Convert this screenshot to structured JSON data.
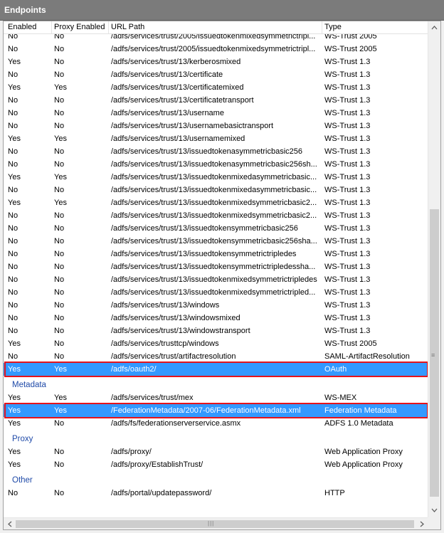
{
  "panel": {
    "title": "Endpoints"
  },
  "columns": [
    "Enabled",
    "Proxy Enabled",
    "URL Path",
    "Type"
  ],
  "groups": [
    {
      "name": "",
      "rows": [
        [
          "No",
          "No",
          "/adfs/services/trust/2005/issuedtokenmixedsymmetrictripl...",
          "WS-Trust 2005"
        ],
        [
          "No",
          "No",
          "/adfs/services/trust/2005/issuedtokenmixedsymmetrictripl...",
          "WS-Trust 2005"
        ],
        [
          "Yes",
          "No",
          "/adfs/services/trust/13/kerberosmixed",
          "WS-Trust 1.3"
        ],
        [
          "No",
          "No",
          "/adfs/services/trust/13/certificate",
          "WS-Trust 1.3"
        ],
        [
          "Yes",
          "Yes",
          "/adfs/services/trust/13/certificatemixed",
          "WS-Trust 1.3"
        ],
        [
          "No",
          "No",
          "/adfs/services/trust/13/certificatetransport",
          "WS-Trust 1.3"
        ],
        [
          "No",
          "No",
          "/adfs/services/trust/13/username",
          "WS-Trust 1.3"
        ],
        [
          "No",
          "No",
          "/adfs/services/trust/13/usernamebasictransport",
          "WS-Trust 1.3"
        ],
        [
          "Yes",
          "Yes",
          "/adfs/services/trust/13/usernamemixed",
          "WS-Trust 1.3"
        ],
        [
          "No",
          "No",
          "/adfs/services/trust/13/issuedtokenasymmetricbasic256",
          "WS-Trust 1.3"
        ],
        [
          "No",
          "No",
          "/adfs/services/trust/13/issuedtokenasymmetricbasic256sh...",
          "WS-Trust 1.3"
        ],
        [
          "Yes",
          "Yes",
          "/adfs/services/trust/13/issuedtokenmixedasymmetricbasic...",
          "WS-Trust 1.3"
        ],
        [
          "No",
          "No",
          "/adfs/services/trust/13/issuedtokenmixedasymmetricbasic...",
          "WS-Trust 1.3"
        ],
        [
          "Yes",
          "Yes",
          "/adfs/services/trust/13/issuedtokenmixedsymmetricbasic2...",
          "WS-Trust 1.3"
        ],
        [
          "No",
          "No",
          "/adfs/services/trust/13/issuedtokenmixedsymmetricbasic2...",
          "WS-Trust 1.3"
        ],
        [
          "No",
          "No",
          "/adfs/services/trust/13/issuedtokensymmetricbasic256",
          "WS-Trust 1.3"
        ],
        [
          "No",
          "No",
          "/adfs/services/trust/13/issuedtokensymmetricbasic256sha...",
          "WS-Trust 1.3"
        ],
        [
          "No",
          "No",
          "/adfs/services/trust/13/issuedtokensymmetrictripledes",
          "WS-Trust 1.3"
        ],
        [
          "No",
          "No",
          "/adfs/services/trust/13/issuedtokensymmetrictripledessha...",
          "WS-Trust 1.3"
        ],
        [
          "No",
          "No",
          "/adfs/services/trust/13/issuedtokenmixedsymmetrictripledes",
          "WS-Trust 1.3"
        ],
        [
          "No",
          "No",
          "/adfs/services/trust/13/issuedtokenmixedsymmetrictripled...",
          "WS-Trust 1.3"
        ],
        [
          "No",
          "No",
          "/adfs/services/trust/13/windows",
          "WS-Trust 1.3"
        ],
        [
          "No",
          "No",
          "/adfs/services/trust/13/windowsmixed",
          "WS-Trust 1.3"
        ],
        [
          "No",
          "No",
          "/adfs/services/trust/13/windowstransport",
          "WS-Trust 1.3"
        ],
        [
          "Yes",
          "No",
          "/adfs/services/trusttcp/windows",
          "WS-Trust 2005"
        ],
        [
          "No",
          "No",
          "/adfs/services/trust/artifactresolution",
          "SAML-ArtifactResolution"
        ],
        [
          "Yes",
          "Yes",
          "/adfs/oauth2/",
          "OAuth"
        ]
      ]
    },
    {
      "name": "Metadata",
      "rows": [
        [
          "Yes",
          "Yes",
          "/adfs/services/trust/mex",
          "WS-MEX"
        ],
        [
          "Yes",
          "Yes",
          "/FederationMetadata/2007-06/FederationMetadata.xml",
          "Federation Metadata"
        ],
        [
          "Yes",
          "No",
          "/adfs/fs/federationserverservice.asmx",
          "ADFS 1.0 Metadata"
        ]
      ]
    },
    {
      "name": "Proxy",
      "rows": [
        [
          "Yes",
          "No",
          "/adfs/proxy/",
          "Web Application Proxy"
        ],
        [
          "Yes",
          "No",
          "/adfs/proxy/EstablishTrust/",
          "Web Application Proxy"
        ]
      ]
    },
    {
      "name": "Other",
      "rows": [
        [
          "No",
          "No",
          "/adfs/portal/updatepassword/",
          "HTTP"
        ]
      ]
    }
  ],
  "selected": [
    "/adfs/oauth2/",
    "/FederationMetadata/2007-06/FederationMetadata.xml"
  ],
  "colors": {
    "selection": "#3399ff",
    "outline": "#e5141b",
    "group": "#1f4aa8",
    "header": "#7b7b7b"
  },
  "icons": {
    "scroll_up": "triangle-up-icon",
    "scroll_down": "triangle-down-icon",
    "scroll_left": "triangle-left-icon",
    "scroll_right": "triangle-right-icon"
  }
}
